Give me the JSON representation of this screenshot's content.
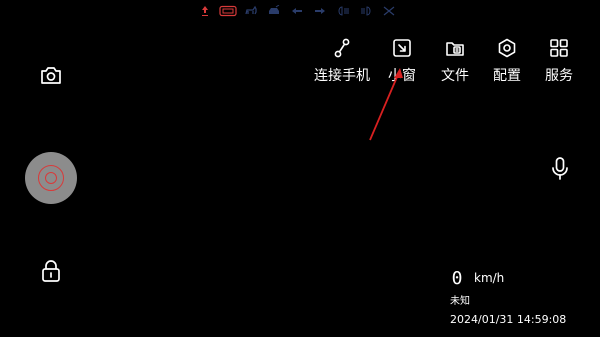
{
  "status_bar": {
    "icons": [
      "driver-alert-icon",
      "adas-icon",
      "dog-icon",
      "car-icon",
      "left-arrow-icon",
      "right-arrow-icon",
      "beam-icon",
      "fog-lamp-icon",
      "crossed-icon"
    ],
    "accent": "#d83a3a"
  },
  "toolbar": {
    "items": [
      {
        "label": "连接手机",
        "icon": "link-icon"
      },
      {
        "label": "小窗",
        "icon": "mini-window-icon"
      },
      {
        "label": "文件",
        "icon": "folder-icon"
      },
      {
        "label": "配置",
        "icon": "settings-icon"
      },
      {
        "label": "服务",
        "icon": "grid-icon"
      }
    ]
  },
  "speed": {
    "value": "0",
    "unit": "km/h"
  },
  "location": "未知",
  "timestamp": "2024/01/31 14:59:08",
  "colors": {
    "background": "#000000",
    "record_button": "#8c8c8c",
    "record_accent": "#d83a3a",
    "annotation_arrow": "#d82020"
  }
}
